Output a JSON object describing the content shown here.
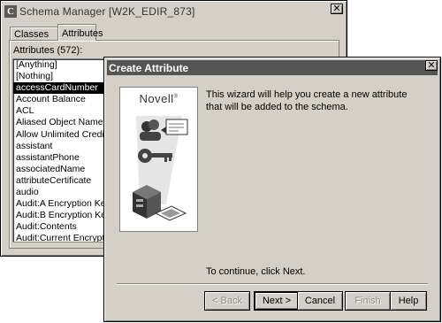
{
  "schema_manager": {
    "title": "Schema Manager [W2K_EDIR_873]",
    "app_icon_glyph": "C",
    "close_glyph": "✕",
    "tabs": [
      {
        "label": "Classes",
        "selected": false
      },
      {
        "label": "Attributes",
        "selected": true
      }
    ],
    "attributes_label": "Attributes (572):",
    "attributes": [
      "[Anything]",
      "[Nothing]",
      "accessCardNumber",
      "Account Balance",
      "ACL",
      "Aliased Object Name",
      "Allow Unlimited Credit",
      "assistant",
      "assistantPhone",
      "associatedName",
      "attributeCertificate",
      "audio",
      "Audit:A Encryption Key",
      "Audit:B Encryption Key",
      "Audit:Contents",
      "Audit:Current Encryption"
    ],
    "selected_attribute": "accessCardNumber"
  },
  "create_attribute_dialog": {
    "title": "Create Attribute",
    "close_glyph": "✕",
    "brand": "Novell",
    "brand_mark": "®",
    "intro_text": "This wizard will help you create a new attribute that will be added to the schema.",
    "continue_text": "To continue, click Next.",
    "buttons": {
      "back": "< Back",
      "next": "Next >",
      "cancel": "Cancel",
      "finish": "Finish",
      "help": "Help"
    },
    "illustration_icons": [
      "user-group-icon",
      "certificate-icon",
      "key-icon",
      "server-icon",
      "card-icon"
    ]
  },
  "colors": {
    "window_face": "#d4d0c8",
    "active_titlebar": "#555555",
    "selection": "#000000"
  }
}
